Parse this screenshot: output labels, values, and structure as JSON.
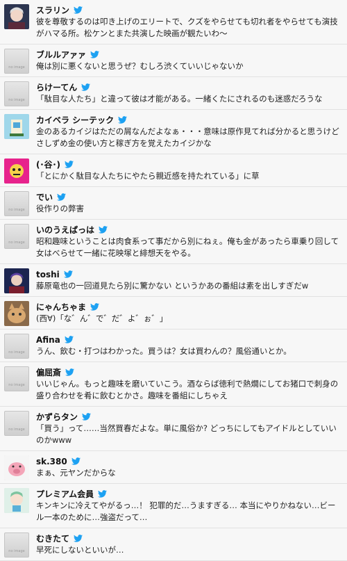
{
  "posts": [
    {
      "name": "スラリン",
      "avatar": "anime-avatar-1",
      "text": "彼を尊敬するのは叩き上げのエリートで、クズをやらせても切れ者をやらせても演技がハマる所。松ケンとまた共演した映画が観たいわ〜"
    },
    {
      "name": "ブルルアァァ",
      "avatar": "no-image",
      "text": "俺は別に悪くないと思うぜ？むしろ渋くていいじゃないか"
    },
    {
      "name": "らけーてん",
      "avatar": "no-image",
      "text": "「駄目な人たち」と違って彼は才能がある。一緒くたにされるのも迷惑だろうな"
    },
    {
      "name": "カイベラ シーテック",
      "avatar": "game-avatar",
      "text": "金のあるカイジはただの屑なんだよなぁ・・・意味は原作見てれば分かると思うけど　さしずめ金の使い方と稼ぎ方を覚えたカイジかな"
    },
    {
      "name": "(･谷･)",
      "avatar": "character-avatar",
      "text": "「とにかく駄目な人たちにやたら親近感を持たれている」に草"
    },
    {
      "name": "でい",
      "avatar": "no-image",
      "text": "役作りの弊害"
    },
    {
      "name": "いのうえぱっは",
      "avatar": "no-image",
      "text": "昭和趣味ということは肉食系って事だから別にねぇ。俺も金があったら車乗り回して女はべらせて一緒に花映塚と緋想天をやる。"
    },
    {
      "name": "toshi",
      "avatar": "anime-avatar-2",
      "text": "藤原竜也の一回道見たら別に驚かない というかあの番組は素を出しすぎだw"
    },
    {
      "name": "にゃんちゃま",
      "avatar": "cat-avatar",
      "text": "(西∀)「な゛ん゛で゛だ゛よ゛ぉ゛」"
    },
    {
      "name": "Afina",
      "avatar": "no-image",
      "text": "うん、飲む・打つはわかった。買うは？女は買わんの？風俗通いとか。"
    },
    {
      "name": "偏屈斎",
      "avatar": "no-image",
      "text": "いいじゃん。もっと趣味を磨いていこう。酒ならば徳利で熱燗にしてお猪口で刺身の盛り合わせを肴に飲むとかさ。趣味を番組にしちゃえ"
    },
    {
      "name": "かずらタン",
      "avatar": "no-image",
      "text": "「買う」って……当然買春だよな。単に風俗か? どっちにしてもアイドルとしていいのかwww"
    },
    {
      "name": "sk.380",
      "avatar": "pig-avatar",
      "text": "まぁ、元ヤンだからな"
    },
    {
      "name": "プレミアム会員",
      "avatar": "chibi-avatar",
      "text": "キンキンに冷えてやがるっ…！ 犯罪的だ…うますぎる… 本当にやりかねない…ビール一本のために…強盗だって…"
    },
    {
      "name": "むきたて",
      "avatar": "no-image",
      "text": "早死にしないといいが…"
    }
  ],
  "no_image_label": "no image",
  "colors": {
    "twitter_blue": "#1da1f2",
    "divider": "#e2e2e2",
    "background": "#f7f7f7"
  }
}
